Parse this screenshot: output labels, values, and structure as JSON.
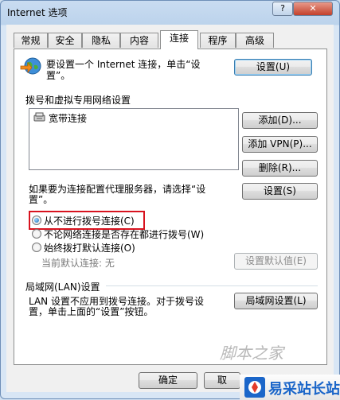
{
  "window": {
    "title": "Internet 选项",
    "help_label": "?",
    "close_label": "✕"
  },
  "tabs": [
    {
      "label": "常规"
    },
    {
      "label": "安全"
    },
    {
      "label": "隐私"
    },
    {
      "label": "内容"
    },
    {
      "label": "连接",
      "active": true
    },
    {
      "label": "程序"
    },
    {
      "label": "高级"
    }
  ],
  "setup": {
    "text_line1": "要设置一个 Internet 连接，单击“设",
    "text_line2": "置”。",
    "button": "设置(U)",
    "icon": "globe-network-icon"
  },
  "dialup": {
    "heading": "拨号和虚拟专用网络设置",
    "connections": [
      {
        "name": "宽带连接",
        "icon": "dialup-connection-icon"
      }
    ],
    "add_button": "添加(D)...",
    "add_vpn_button": "添加 VPN(P)...",
    "delete_button": "删除(R)..."
  },
  "proxy": {
    "text_line1": "如果要为连接配置代理服务器，请选择“设",
    "text_line2": "置”。",
    "settings_button": "设置(S)"
  },
  "dial_options": [
    {
      "label": "从不进行拨号连接(C)",
      "checked": true
    },
    {
      "label": "不论网络连接是否存在都进行拨号(W)",
      "checked": false
    },
    {
      "label": "始终拨打默认连接(O)",
      "checked": false
    }
  ],
  "default_connection": {
    "label": "当前默认连接: 无",
    "button": "设置默认值(E)"
  },
  "lan": {
    "heading": "局域网(LAN)设置",
    "text_line1": "LAN 设置不应用到拨号连接。对于拨号设",
    "text_line2": "置，单击上面的“设置”按钮。",
    "button": "局域网设置(L)"
  },
  "footer": {
    "ok_button": "确定",
    "cancel_button": "取"
  },
  "watermark": {
    "script_text": "脚本之家",
    "site_text": "易采站长站"
  },
  "colors": {
    "highlight": "#d8131f",
    "accent": "#3c7fb1"
  }
}
